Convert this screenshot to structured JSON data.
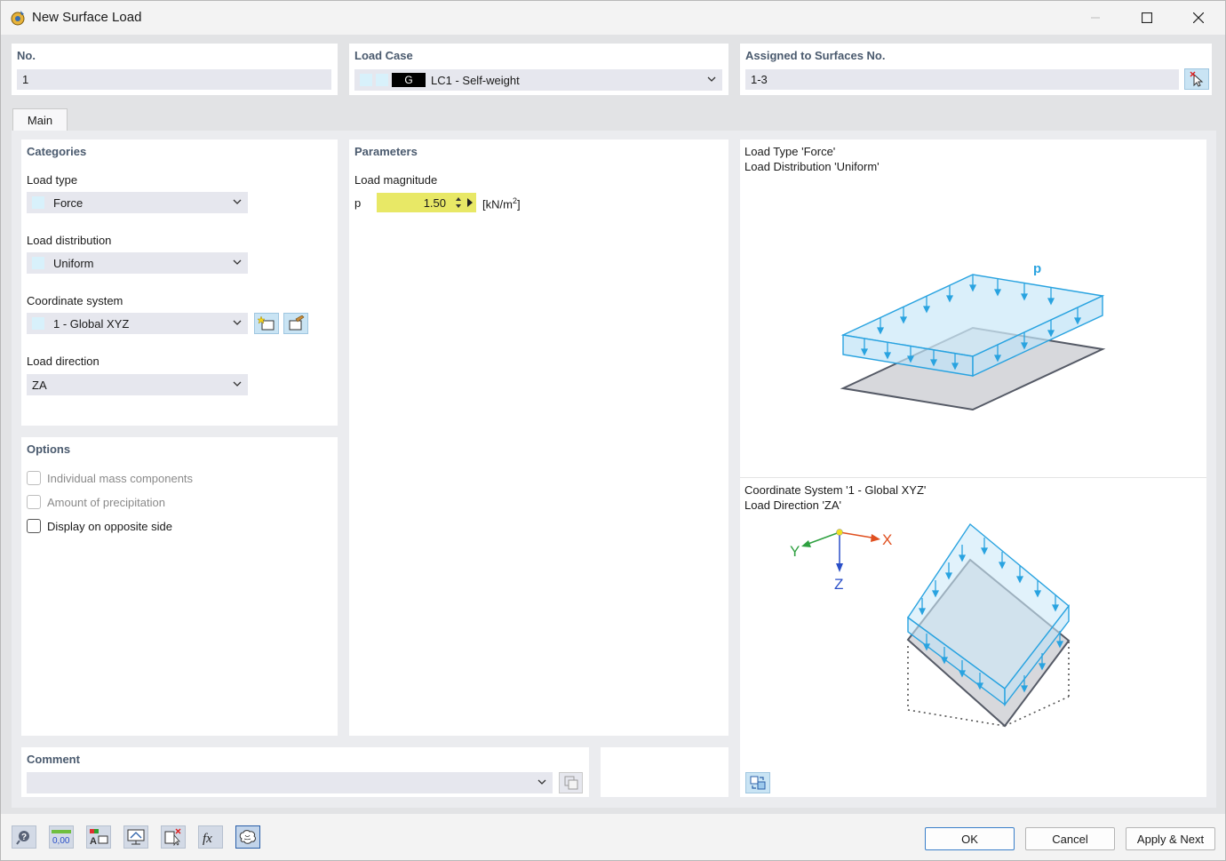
{
  "window": {
    "title": "New Surface Load"
  },
  "header": {
    "no": {
      "label": "No.",
      "value": "1"
    },
    "load_case": {
      "label": "Load Case",
      "tag": "G",
      "value": "LC1 - Self-weight"
    },
    "assigned": {
      "label": "Assigned to Surfaces No.",
      "value": "1-3"
    }
  },
  "tabs": [
    {
      "label": "Main"
    }
  ],
  "categories": {
    "title": "Categories",
    "load_type": {
      "label": "Load type",
      "value": "Force"
    },
    "load_distribution": {
      "label": "Load distribution",
      "value": "Uniform"
    },
    "coordinate_system": {
      "label": "Coordinate system",
      "value": "1 - Global XYZ"
    },
    "load_direction": {
      "label": "Load direction",
      "value": "ZA"
    }
  },
  "options": {
    "title": "Options",
    "items": [
      {
        "label": "Individual mass components",
        "checked": false,
        "enabled": false
      },
      {
        "label": "Amount of precipitation",
        "checked": false,
        "enabled": false
      },
      {
        "label": "Display on opposite side",
        "checked": false,
        "enabled": true
      }
    ]
  },
  "parameters": {
    "title": "Parameters",
    "load_magnitude_label": "Load magnitude",
    "symbol": "p",
    "value": "1.50",
    "unit_prefix": "[kN/m",
    "unit_exp": "2",
    "unit_suffix": "]"
  },
  "diagram": {
    "top_line1": "Load Type 'Force'",
    "top_line2": "Load Distribution 'Uniform'",
    "load_label": "p",
    "bottom_line1": "Coordinate System '1 - Global XYZ'",
    "bottom_line2": "Load Direction 'ZA'",
    "axis_x": "X",
    "axis_y": "Y",
    "axis_z": "Z"
  },
  "comment": {
    "title": "Comment",
    "value": ""
  },
  "buttons": {
    "ok": "OK",
    "cancel": "Cancel",
    "apply_next": "Apply & Next"
  },
  "bottom_toolbar": {
    "numeric_icon_text": "0,00"
  },
  "colors": {
    "load_blue": "#29a3e0",
    "load_fill": "#cdeaf8",
    "plate_fill": "#d7d8dc",
    "plate_edge": "#555a66",
    "highlight_yellow": "#e8e866",
    "panel_title": "#4a5a6e"
  }
}
